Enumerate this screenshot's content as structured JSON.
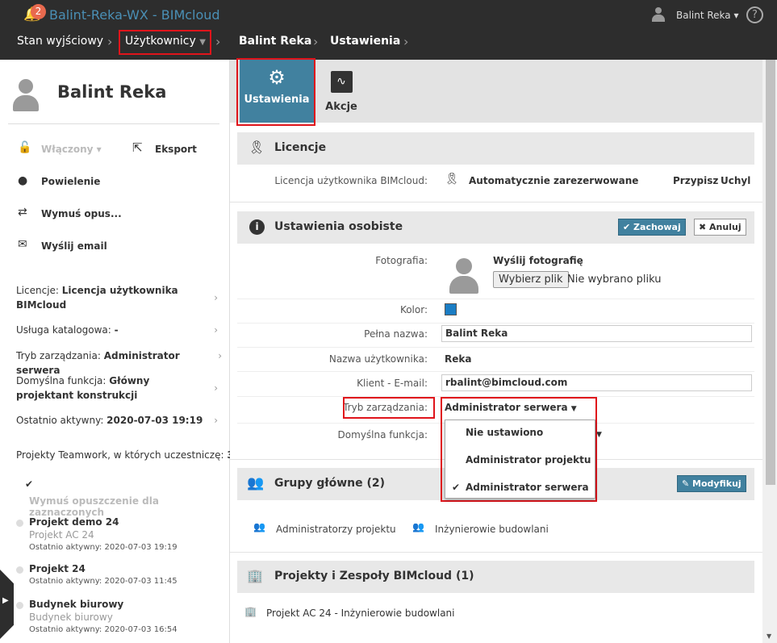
{
  "header": {
    "notification_count": "2",
    "app_title": "Balint-Reka-WX - BIMcloud",
    "user": "Balint Reka",
    "help": "?"
  },
  "breadcrumb": [
    "Stan wyjściowy",
    "Użytkownicy",
    "Balint Reka",
    "Ustawienia"
  ],
  "sidebar": {
    "user_name": "Balint Reka",
    "status": "Włączony",
    "export": "Eksport",
    "duplicate": "Powielenie",
    "force_leave": "Wymuś opus...",
    "send_email": "Wyślij email",
    "info": [
      {
        "label": "Licencje: ",
        "value": "Licencja użytkownika BIMcloud"
      },
      {
        "label": "Usługa katalogowa: ",
        "value": "-"
      },
      {
        "label": "Tryb zarządzania: ",
        "value": "Administrator serwera"
      },
      {
        "label": "Domyślna funkcja: ",
        "value": "Główny projektant konstrukcji"
      },
      {
        "label": "Ostatnio aktywny: ",
        "value": "2020-07-03 19:19"
      }
    ],
    "projects_label": "Projekty Teamwork, w których uczestniczę: ",
    "projects_count": "3",
    "force_leave_selected": "Wymuś opuszczenie dla zaznaczonych",
    "projects": [
      {
        "name": "Projekt demo 24",
        "sub": "Projekt AC 24",
        "last": "Ostatnio aktywny: 2020-07-03 19:19"
      },
      {
        "name": "Projekt 24",
        "sub": "",
        "last": "Ostatnio aktywny: 2020-07-03 11:45"
      },
      {
        "name": "Budynek biurowy",
        "sub": "Budynek biurowy",
        "last": "Ostatnio aktywny: 2020-07-03 16:54"
      }
    ]
  },
  "tabs": [
    {
      "label": "Ustawienia"
    },
    {
      "label": "Akcje"
    }
  ],
  "licenses": {
    "title": "Licencje",
    "row_label": "Licencja użytkownika BIMcloud:",
    "value": "Automatycznie zarezerwowane",
    "assign": "Przypisz",
    "revoke": "Uchyl"
  },
  "personal": {
    "title": "Ustawienia osobiste",
    "save": "Zachowaj",
    "cancel": "Anuluj",
    "photo_label": "Fotografia:",
    "send_photo": "Wyślij fotografię",
    "choose_file": "Wybierz plik",
    "no_file": "Nie wybrano pliku",
    "color_label": "Kolor:",
    "color": "#1a7dc4",
    "fullname_label": "Pełna nazwa:",
    "fullname": "Balint Reka",
    "username_label": "Nazwa użytkownika:",
    "username": "Reka",
    "email_label": "Klient - E-mail:",
    "email": "rbalint@bimcloud.com",
    "mode_label": "Tryb zarządzania:",
    "mode": "Administrator serwera",
    "role_label": "Domyślna funkcja:",
    "mode_options": [
      "Nie ustawiono",
      "Administrator projektu",
      "Administrator serwera"
    ]
  },
  "groups": {
    "title": "Grupy główne (2)",
    "modify": "Modyfikuj",
    "items": [
      "Administratorzy projektu",
      "Inżynierowie budowlani"
    ]
  },
  "projects": {
    "title": "Projekty i Zespoły BIMcloud (1)",
    "items": [
      "Projekt AC 24 - Inżynierowie budowlani"
    ]
  }
}
